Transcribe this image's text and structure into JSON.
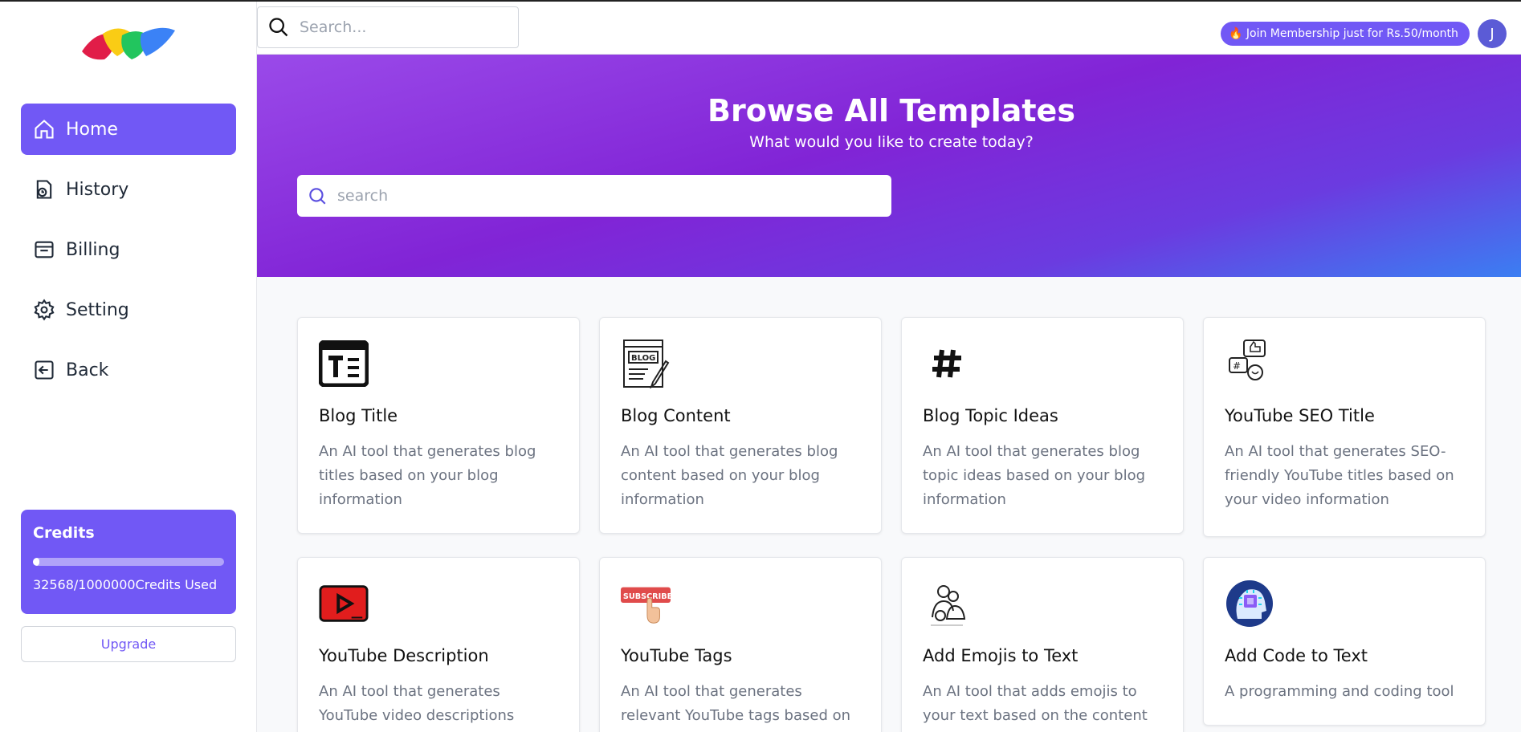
{
  "sidebar": {
    "items": [
      {
        "label": "Home",
        "icon": "home-icon",
        "active": true
      },
      {
        "label": "History",
        "icon": "history-icon",
        "active": false
      },
      {
        "label": "Billing",
        "icon": "billing-icon",
        "active": false
      },
      {
        "label": "Setting",
        "icon": "gear-icon",
        "active": false
      },
      {
        "label": "Back",
        "icon": "back-icon",
        "active": false
      }
    ],
    "credits": {
      "title": "Credits",
      "used_text": "32568/1000000Credits Used",
      "used_fraction": 0.033
    },
    "upgrade_label": "Upgrade"
  },
  "topbar": {
    "search_placeholder": "Search...",
    "membership_label": "🔥 Join Membership just for Rs.50/month",
    "avatar_initial": "J"
  },
  "hero": {
    "title": "Browse All Templates",
    "subtitle": "What would you like to create today?",
    "search_placeholder": "search"
  },
  "templates": [
    {
      "name": "Blog Title",
      "desc": "An AI tool that generates blog titles based on your blog information",
      "icon": "text-title-icon"
    },
    {
      "name": "Blog Content",
      "desc": "An AI tool that generates blog content based on your blog information",
      "icon": "blog-icon"
    },
    {
      "name": "Blog Topic Ideas",
      "desc": "An AI tool that generates blog topic ideas based on your blog information",
      "icon": "hashtag-icon"
    },
    {
      "name": "YouTube SEO Title",
      "desc": "An AI tool that generates SEO-friendly YouTube titles based on your video information",
      "icon": "social-seo-icon"
    },
    {
      "name": "YouTube Description",
      "desc": "An AI tool that generates YouTube video descriptions based",
      "icon": "youtube-play-icon"
    },
    {
      "name": "YouTube Tags",
      "desc": "An AI tool that generates relevant YouTube tags based on your",
      "icon": "subscribe-icon"
    },
    {
      "name": "Add Emojis to Text",
      "desc": "An AI tool that adds emojis to your text based on the content",
      "icon": "people-emoji-icon"
    },
    {
      "name": "Add Code to Text",
      "desc": "A programming and coding tool",
      "icon": "ai-head-icon"
    }
  ],
  "colors": {
    "accent": "#7158f5",
    "hero_start": "#9a4ae9",
    "hero_end": "#3b7ef2"
  }
}
